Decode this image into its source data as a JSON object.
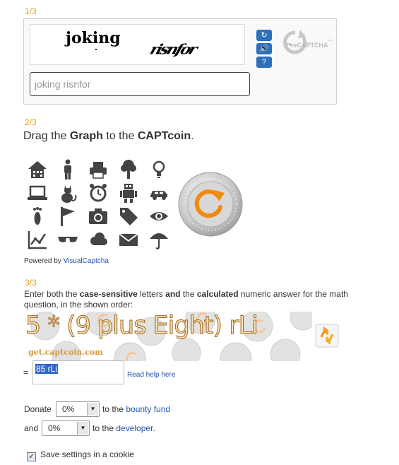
{
  "step1": {
    "label": "1/3"
  },
  "recaptcha": {
    "word1": "joking",
    "word2": "risnfor",
    "input_value": "joking risnfor",
    "logo_text": "reCAPTCHA",
    "logo_tm": "™",
    "logo_small": "re"
  },
  "step2": {
    "label": "2/3",
    "instruction": {
      "pre": "Drag the ",
      "bold1": "Graph",
      "mid": " to the ",
      "bold2": "CAPTcoin",
      "post": "."
    },
    "icons": [
      "home-icon",
      "person-icon",
      "printer-icon",
      "tree-icon",
      "lightbulb-icon",
      "laptop-icon",
      "cat-icon",
      "alarm-clock-icon",
      "robot-icon",
      "car-icon",
      "footprint-icon",
      "flag-icon",
      "camera-icon",
      "tag-icon",
      "eye-icon",
      "graph-icon",
      "sunglasses-icon",
      "cloud-icon",
      "envelope-icon",
      "umbrella-icon"
    ],
    "powered_by": "Powered by ",
    "powered_link": "VisualCaptcha"
  },
  "step3": {
    "label": "3/3",
    "text_pre": "Enter both the ",
    "bold1": "case-sensitive",
    "text_mid1": " letters ",
    "bold2": "and",
    "text_mid2": " the ",
    "bold3": "calculated",
    "text_post": " numeric answer for the math question, in the shown order:",
    "captcha_text": "5 * (9 plus Eight) rLi",
    "watermark": "get.captcoin.com",
    "eq": "=",
    "input_value": "85 rLi",
    "help": "Read help here"
  },
  "donate": {
    "label1": "Donate",
    "value1": "0%",
    "to1": " to the ",
    "link1": "bounty fund",
    "label2": "and",
    "value2": "0%",
    "to2": " to the ",
    "link2": "developer",
    "end2": "."
  },
  "cookie": {
    "label": "Save settings in a cookie",
    "checked_mark": "✓"
  },
  "colors": {
    "accent_orange": "#e8a020",
    "link_blue": "#2255aa",
    "recap_blue": "#2c6fbb"
  }
}
